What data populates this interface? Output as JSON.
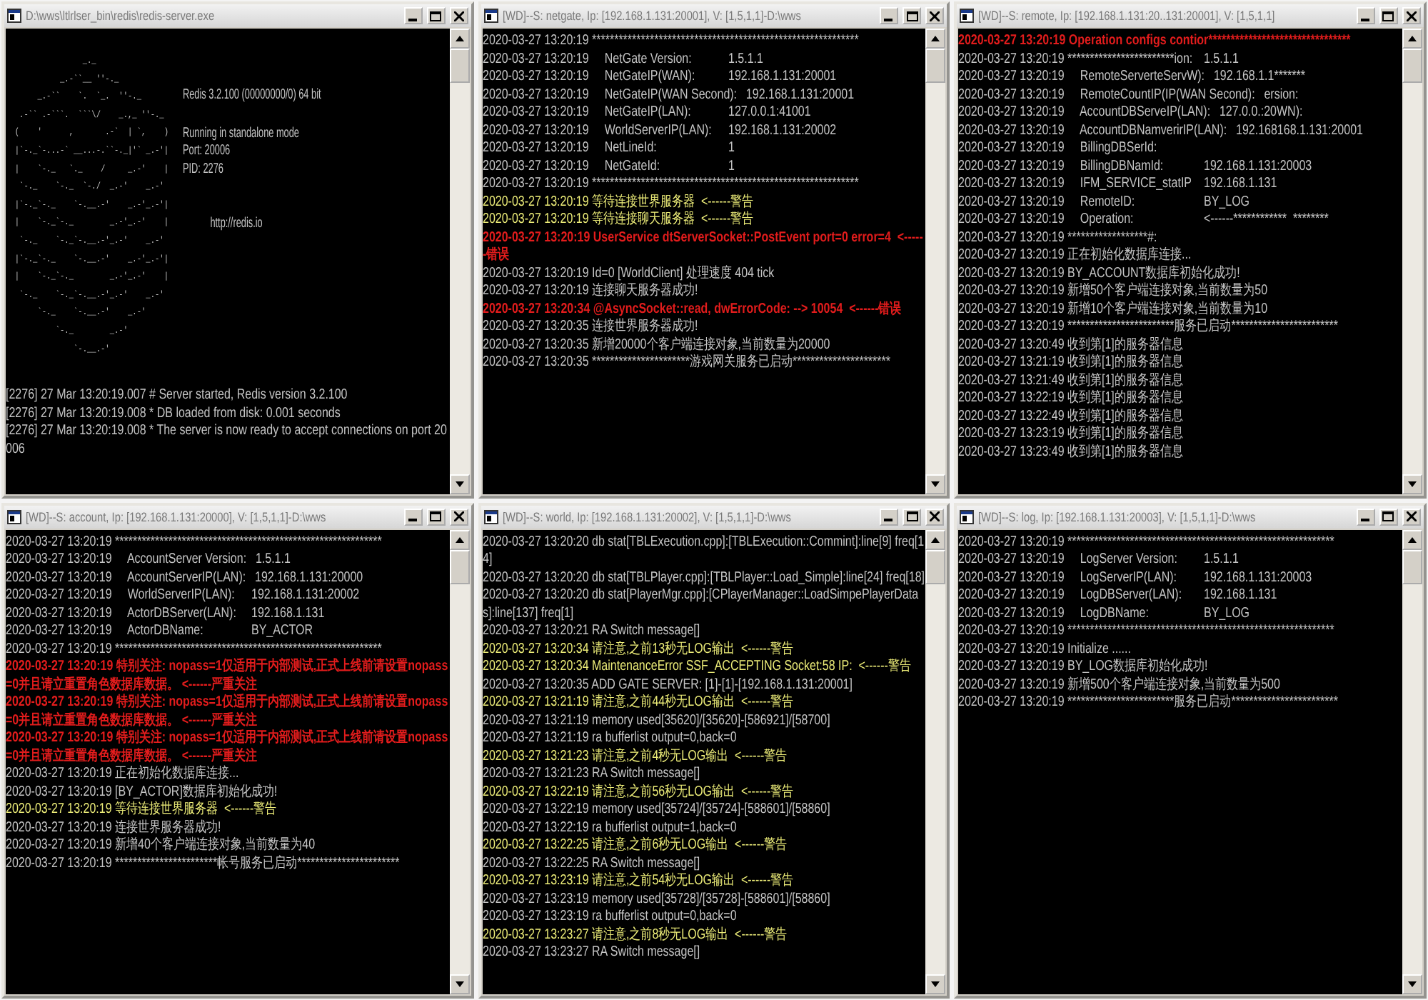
{
  "windows": [
    {
      "kind": "redis",
      "title": "D:\\wws\\ltlrlser_bin\\redis\\redis-server.exe",
      "art": [
        "                _._",
        "           _.-``__ ''-._",
        "      _.-``    `.  `_.  ''-._",
        "  .-`` .-```.  ```\\/    _.,_ ''-._",
        " (    '      ,       .-`  | `,    )",
        " |`-._`-...-` __...-.``-._|'` _.-'|",
        " |    `-._   `._    /     _.-'    |",
        "  `-._    `-._  `-./  _.-'    _.-'",
        " |`-._`-._    `-.__.-'    _.-'_.-'|",
        " |    `-._`-._        _.-'_.-'    |",
        "  `-._    `-._`-.__.-'_.-'    _.-'",
        " |`-._`-._    `-.__.-'    _.-'_.-'|",
        " |    `-._`-._        _.-'_.-'    |",
        "  `-._    `-._`-.__.-'_.-'    _.-'",
        "      `-._    `-.__.-'    _.-'",
        "          `-._        _.-'",
        "              `-.__.-'"
      ],
      "version": "Redis 3.2.100 (00000000/0) 64 bit",
      "details": [
        "Running in standalone mode",
        "Port: 20006",
        "PID: 2276"
      ],
      "url": "http://redis.io",
      "lines": [
        {
          "text": "[2276] 27 Mar 13:20:19.007 # Server started, Redis version 3.2.100",
          "kind": "normal"
        },
        {
          "text": "[2276] 27 Mar 13:20:19.008 * DB loaded from disk: 0.001 seconds",
          "kind": "normal"
        },
        {
          "text": "[2276] 27 Mar 13:20:19.008 * The server is now ready to accept connections on port 20006",
          "kind": "normal"
        }
      ]
    },
    {
      "kind": "log",
      "title": "[WD]--S: netgate, Ip: [192.168.1.131:20001], V: [1,5,1,1]-D:\\wws",
      "lines": [
        {
          "text": "2020-03-27 13:20:19 ************************************************************",
          "kind": "normal"
        },
        {
          "text": "2020-03-27 13:20:19     NetGate Version:",
          "value": "1.5.1.1",
          "kind": "normal"
        },
        {
          "text": "2020-03-27 13:20:19     NetGateIP(WAN):",
          "value": "192.168.1.131:20001",
          "kind": "normal"
        },
        {
          "text": "2020-03-27 13:20:19     NetGateIP(WAN Second):",
          "value": "192.168.1.131:20001",
          "kind": "normal"
        },
        {
          "text": "2020-03-27 13:20:19     NetGateIP(LAN):",
          "value": "127.0.0.1:41001",
          "kind": "normal"
        },
        {
          "text": "2020-03-27 13:20:19     WorldServerIP(LAN):",
          "value": "192.168.1.131:20002",
          "kind": "normal"
        },
        {
          "text": "2020-03-27 13:20:19     NetLineId:",
          "value": "1",
          "kind": "normal"
        },
        {
          "text": "2020-03-27 13:20:19     NetGateId:",
          "value": "1",
          "kind": "normal"
        },
        {
          "text": "2020-03-27 13:20:19 ************************************************************",
          "kind": "normal"
        },
        {
          "text": "2020-03-27 13:20:19 等待连接世界服务器  <------警告",
          "kind": "warn"
        },
        {
          "text": "2020-03-27 13:20:19 等待连接聊天服务器  <------警告",
          "kind": "warn"
        },
        {
          "text": "2020-03-27 13:20:19 UserService dtServerSocket::PostEvent port=0 error=4  <------错误",
          "kind": "error"
        },
        {
          "text": "2020-03-27 13:20:19 Id=0 [WorldClient] 处理速度 404 tick",
          "kind": "normal"
        },
        {
          "text": "2020-03-27 13:20:19 连接聊天服务器成功!",
          "kind": "normal"
        },
        {
          "text": "2020-03-27 13:20:34 @AsyncSocket::read, dwErrorCode: --> 10054  <------错误",
          "kind": "error"
        },
        {
          "text": "2020-03-27 13:20:35 连接世界服务器成功!",
          "kind": "normal"
        },
        {
          "text": "2020-03-27 13:20:35 新增20000个客户端连接对象,当前数量为20000",
          "kind": "normal"
        },
        {
          "text": "2020-03-27 13:20:35 **********************游戏网关服务已启动**********************",
          "kind": "normal"
        }
      ]
    },
    {
      "kind": "log",
      "title": "[WD]--S: remote, Ip: [192.168.1.131:20..131:20001], V: [1,5,1,1]",
      "lines": [
        {
          "text": "2020-03-27 13:20:19 Operation configs contior********************************",
          "kind": "error"
        },
        {
          "text": "2020-03-27 13:20:19 ************************ion:",
          "value": "1.5.1.1",
          "kind": "normal"
        },
        {
          "text": "2020-03-27 13:20:19     RemoteServerteServW):",
          "value": "192.168.1.1*******",
          "kind": "normal"
        },
        {
          "text": "2020-03-27 13:20:19     RemoteCountIP(IP(WAN Second):",
          "value": "ersion:",
          "kind": "normal"
        },
        {
          "text": "2020-03-27 13:20:19     AccountDBServeIP(LAN):",
          "value": "127.0.0.:20WN):",
          "kind": "normal"
        },
        {
          "text": "2020-03-27 13:20:19     AccountDBNamverirIP(LAN):",
          "value": "192.168168.1.131:20001",
          "kind": "normal"
        },
        {
          "text": "2020-03-27 13:20:19     BillingDBSerId:",
          "kind": "normal"
        },
        {
          "text": "2020-03-27 13:20:19     BillingDBNamId:",
          "value": "192.168.1.131:20003",
          "kind": "normal"
        },
        {
          "text": "2020-03-27 13:20:19     IFM_SERVICE_statIP",
          "value": "192.168.1.131",
          "kind": "normal"
        },
        {
          "text": "2020-03-27 13:20:19     RemoteID:",
          "value": "BY_LOG",
          "kind": "normal"
        },
        {
          "text": "2020-03-27 13:20:19     Operation:",
          "value": "<------************  ********",
          "kind": "normal"
        },
        {
          "text": "2020-03-27 13:20:19 ******************#:",
          "kind": "normal"
        },
        {
          "text": "2020-03-27 13:20:19 正在初始化数据库连接...",
          "kind": "normal"
        },
        {
          "text": "2020-03-27 13:20:19 BY_ACCOUNT数据库初始化成功!",
          "kind": "normal"
        },
        {
          "text": "2020-03-27 13:20:19 新增50个客户端连接对象,当前数量为50",
          "kind": "normal"
        },
        {
          "text": "2020-03-27 13:20:19 新增10个客户端连接对象,当前数量为10",
          "kind": "normal"
        },
        {
          "text": "2020-03-27 13:20:19 ************************服务已启动************************",
          "kind": "normal"
        },
        {
          "text": "2020-03-27 13:20:49 收到第[1]的服务器信息",
          "kind": "normal"
        },
        {
          "text": "2020-03-27 13:21:19 收到第[1]的服务器信息",
          "kind": "normal"
        },
        {
          "text": "2020-03-27 13:21:49 收到第[1]的服务器信息",
          "kind": "normal"
        },
        {
          "text": "2020-03-27 13:22:19 收到第[1]的服务器信息",
          "kind": "normal"
        },
        {
          "text": "2020-03-27 13:22:49 收到第[1]的服务器信息",
          "kind": "normal"
        },
        {
          "text": "2020-03-27 13:23:19 收到第[1]的服务器信息",
          "kind": "normal"
        },
        {
          "text": "2020-03-27 13:23:49 收到第[1]的服务器信息",
          "kind": "normal"
        }
      ]
    },
    {
      "kind": "log",
      "title": "[WD]--S: account, Ip: [192.168.1.131:20000], V: [1,5,1,1]-D:\\wws",
      "lines": [
        {
          "text": "2020-03-27 13:20:19 ************************************************************",
          "kind": "normal"
        },
        {
          "text": "2020-03-27 13:20:19     AccountServer Version:",
          "value": "1.5.1.1",
          "kind": "normal"
        },
        {
          "text": "2020-03-27 13:20:19     AccountServerIP(LAN):",
          "value": "192.168.1.131:20000",
          "kind": "normal"
        },
        {
          "text": "2020-03-27 13:20:19     WorldServerIP(LAN):",
          "value": "192.168.1.131:20002",
          "kind": "normal"
        },
        {
          "text": "2020-03-27 13:20:19     ActorDBServer(LAN):",
          "value": "192.168.1.131",
          "kind": "normal"
        },
        {
          "text": "2020-03-27 13:20:19     ActorDBName:",
          "value": "BY_ACTOR",
          "kind": "normal"
        },
        {
          "text": "2020-03-27 13:20:19 ************************************************************",
          "kind": "normal"
        },
        {
          "text": "2020-03-27 13:20:19 特别关注: nopass=1仅适用于内部测试,正式上线前请设置nopass=0并且请立重置角色数据库数据。 <------严重关注",
          "kind": "error"
        },
        {
          "text": "2020-03-27 13:20:19 特别关注: nopass=1仅适用于内部测试,正式上线前请设置nopass=0并且请立重置角色数据库数据。 <------严重关注",
          "kind": "error"
        },
        {
          "text": "2020-03-27 13:20:19 特别关注: nopass=1仅适用于内部测试,正式上线前请设置nopass=0并且请立重置角色数据库数据。 <------严重关注",
          "kind": "error"
        },
        {
          "text": "2020-03-27 13:20:19 正在初始化数据库连接...",
          "kind": "normal"
        },
        {
          "text": "2020-03-27 13:20:19 [BY_ACTOR]数据库初始化成功!",
          "kind": "normal"
        },
        {
          "text": "2020-03-27 13:20:19 等待连接世界服务器  <------警告",
          "kind": "warn"
        },
        {
          "text": "2020-03-27 13:20:19 连接世界服务器成功!",
          "kind": "normal"
        },
        {
          "text": "2020-03-27 13:20:19 新增40个客户端连接对象,当前数量为40",
          "kind": "normal"
        },
        {
          "text": "2020-03-27 13:20:19 ***********************帐号服务已启动***********************",
          "kind": "normal"
        }
      ]
    },
    {
      "kind": "log",
      "title": "[WD]--S: world, Ip: [192.168.1.131:20002], V: [1,5,1,1]-D:\\wws",
      "lines": [
        {
          "text": "2020-03-27 13:20:20 db stat[TBLExecution.cpp]:[TBLExecution::Commint]:line[9] freq[14]",
          "kind": "normal"
        },
        {
          "text": "2020-03-27 13:20:20 db stat[TBLPlayer.cpp]:[TBLPlayer::Load_Simple]:line[24] freq[18]",
          "kind": "normal"
        },
        {
          "text": "2020-03-27 13:20:20 db stat[PlayerMgr.cpp]:[CPlayerManager::LoadSimpePlayerDatas]:line[137] freq[1]",
          "kind": "normal"
        },
        {
          "text": "2020-03-27 13:20:21 RA Switch message[]",
          "kind": "normal"
        },
        {
          "text": "2020-03-27 13:20:34 请注意,之前13秒无LOG输出  <------警告",
          "kind": "warn"
        },
        {
          "text": "2020-03-27 13:20:34 MaintenanceError SSF_ACCEPTING Socket:58 IP:  <------警告",
          "kind": "warn"
        },
        {
          "text": "2020-03-27 13:20:35 ADD GATE SERVER: [1]-[1]-[192.168.1.131:20001]",
          "kind": "normal"
        },
        {
          "text": "2020-03-27 13:21:19 请注意,之前44秒无LOG输出  <------警告",
          "kind": "warn"
        },
        {
          "text": "2020-03-27 13:21:19 memory used[35620]/[35620]-[586921]/[58700]",
          "kind": "normal"
        },
        {
          "text": "2020-03-27 13:21:19 ra bufferlist output=0,back=0",
          "kind": "normal"
        },
        {
          "text": "2020-03-27 13:21:23 请注意,之前4秒无LOG输出  <------警告",
          "kind": "warn"
        },
        {
          "text": "2020-03-27 13:21:23 RA Switch message[]",
          "kind": "normal"
        },
        {
          "text": "2020-03-27 13:22:19 请注意,之前56秒无LOG输出  <------警告",
          "kind": "warn"
        },
        {
          "text": "2020-03-27 13:22:19 memory used[35724]/[35724]-[588601]/[58860]",
          "kind": "normal"
        },
        {
          "text": "2020-03-27 13:22:19 ra bufferlist output=1,back=0",
          "kind": "normal"
        },
        {
          "text": "2020-03-27 13:22:25 请注意,之前6秒无LOG输出  <------警告",
          "kind": "warn"
        },
        {
          "text": "2020-03-27 13:22:25 RA Switch message[]",
          "kind": "normal"
        },
        {
          "text": "2020-03-27 13:23:19 请注意,之前54秒无LOG输出  <------警告",
          "kind": "warn"
        },
        {
          "text": "2020-03-27 13:23:19 memory used[35728]/[35728]-[588601]/[58860]",
          "kind": "normal"
        },
        {
          "text": "2020-03-27 13:23:19 ra bufferlist output=0,back=0",
          "kind": "normal"
        },
        {
          "text": "2020-03-27 13:23:27 请注意,之前8秒无LOG输出  <------警告",
          "kind": "warn"
        },
        {
          "text": "2020-03-27 13:23:27 RA Switch message[]",
          "kind": "normal"
        }
      ]
    },
    {
      "kind": "log",
      "title": "[WD]--S: log, Ip: [192.168.1.131:20003], V: [1,5,1,1]-D:\\wws",
      "lines": [
        {
          "text": "2020-03-27 13:20:19 ************************************************************",
          "kind": "normal"
        },
        {
          "text": "2020-03-27 13:20:19     LogServer Version:",
          "value": "1.5.1.1",
          "kind": "normal"
        },
        {
          "text": "2020-03-27 13:20:19     LogServerIP(LAN):",
          "value": "192.168.1.131:20003",
          "kind": "normal"
        },
        {
          "text": "2020-03-27 13:20:19     LogDBServer(LAN):",
          "value": "192.168.1.131",
          "kind": "normal"
        },
        {
          "text": "2020-03-27 13:20:19     LogDBName:",
          "value": "BY_LOG",
          "kind": "normal"
        },
        {
          "text": "2020-03-27 13:20:19 ************************************************************",
          "kind": "normal"
        },
        {
          "text": "2020-03-27 13:20:19 Initialize ......",
          "kind": "normal"
        },
        {
          "text": "2020-03-27 13:20:19 BY_LOG数据库初始化成功!",
          "kind": "normal"
        },
        {
          "text": "2020-03-27 13:20:19 新增500个客户端连接对象,当前数量为500",
          "kind": "normal"
        },
        {
          "text": "2020-03-27 13:20:19 ************************服务已启动************************",
          "kind": "normal"
        }
      ]
    }
  ]
}
